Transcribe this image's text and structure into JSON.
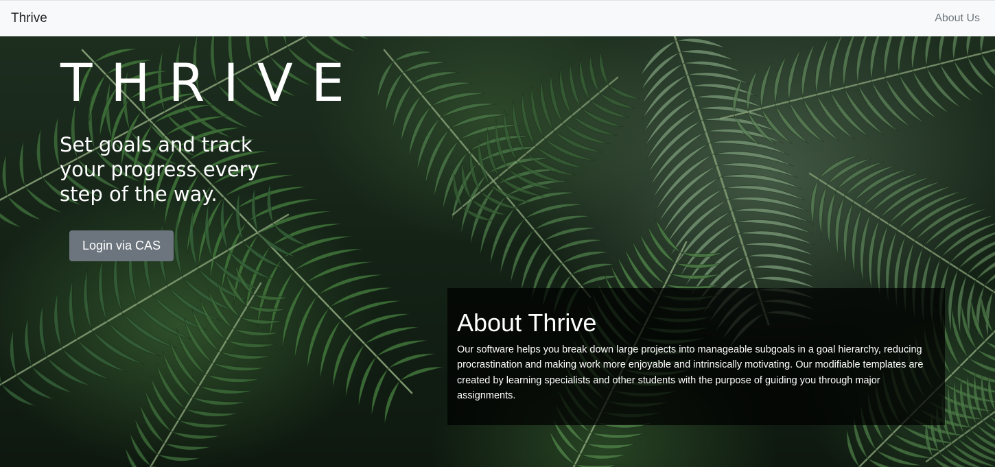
{
  "navbar": {
    "brand": "Thrive",
    "about_link": "About Us"
  },
  "hero": {
    "title": "THRIVE",
    "tagline": "Set goals and track your progress every step of the way.",
    "login_button": "Login via CAS"
  },
  "about": {
    "title": "About Thrive",
    "body": "Our software helps you break down large projects into manageable subgoals in a goal hierarchy, reducing procrastination and making work more enjoyable and intrinsically motivating. Our modifiable templates are created by learning specialists and other students with the purpose of guiding you through major assignments."
  },
  "colors": {
    "navbar_bg": "#f8f9fa",
    "button_bg": "#6c757d",
    "panel_bg": "rgba(0,0,0,0.72)",
    "leaf_green": "#3f6b3d"
  },
  "icons": [
    "palm-leaf-background-image"
  ]
}
